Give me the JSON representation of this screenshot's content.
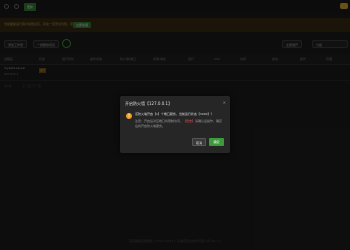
{
  "topbar": {
    "button_label": "更新"
  },
  "notice": {
    "text": "当前面板运行用户权限过高，存在一定安全风险，建议及时处理",
    "button_label": "立即处理"
  },
  "toolbar": {
    "add_label": "添加工作项",
    "more_label": "一键删除项目",
    "right_btn1": "全部展开",
    "right_btn2": "分组"
  },
  "table": {
    "headers": [
      "进程名",
      "状态",
      "运行时长",
      "操作系统",
      "防火墙/端口",
      "商家/域名",
      "运行",
      "CPU",
      "内存",
      "启动",
      "操作",
      "管理"
    ],
    "row": {
      "name": "mysqld-server",
      "sub": "127.0.0.1",
      "tag": "运行"
    }
  },
  "pager": {
    "left": "共1条",
    "right": "上一页 下一页"
  },
  "modal": {
    "title": "开启防火墙【127.0.0.1】",
    "message": "该防火墙开启【1】个端口服务，当前运行状态【3000】？",
    "note_prefix": "注意：开启后对应端口将限制访问，",
    "note_red": "【警告】",
    "note_suffix": "请确认后操作，确定后将开启防火墙服务。",
    "cancel_label": "取消",
    "confirm_label": "确定"
  },
  "footer": {
    "text": "宝塔面板运维面板 ©2014-2022 广东堡塔安全技术有限公司 (bt.cn)"
  }
}
